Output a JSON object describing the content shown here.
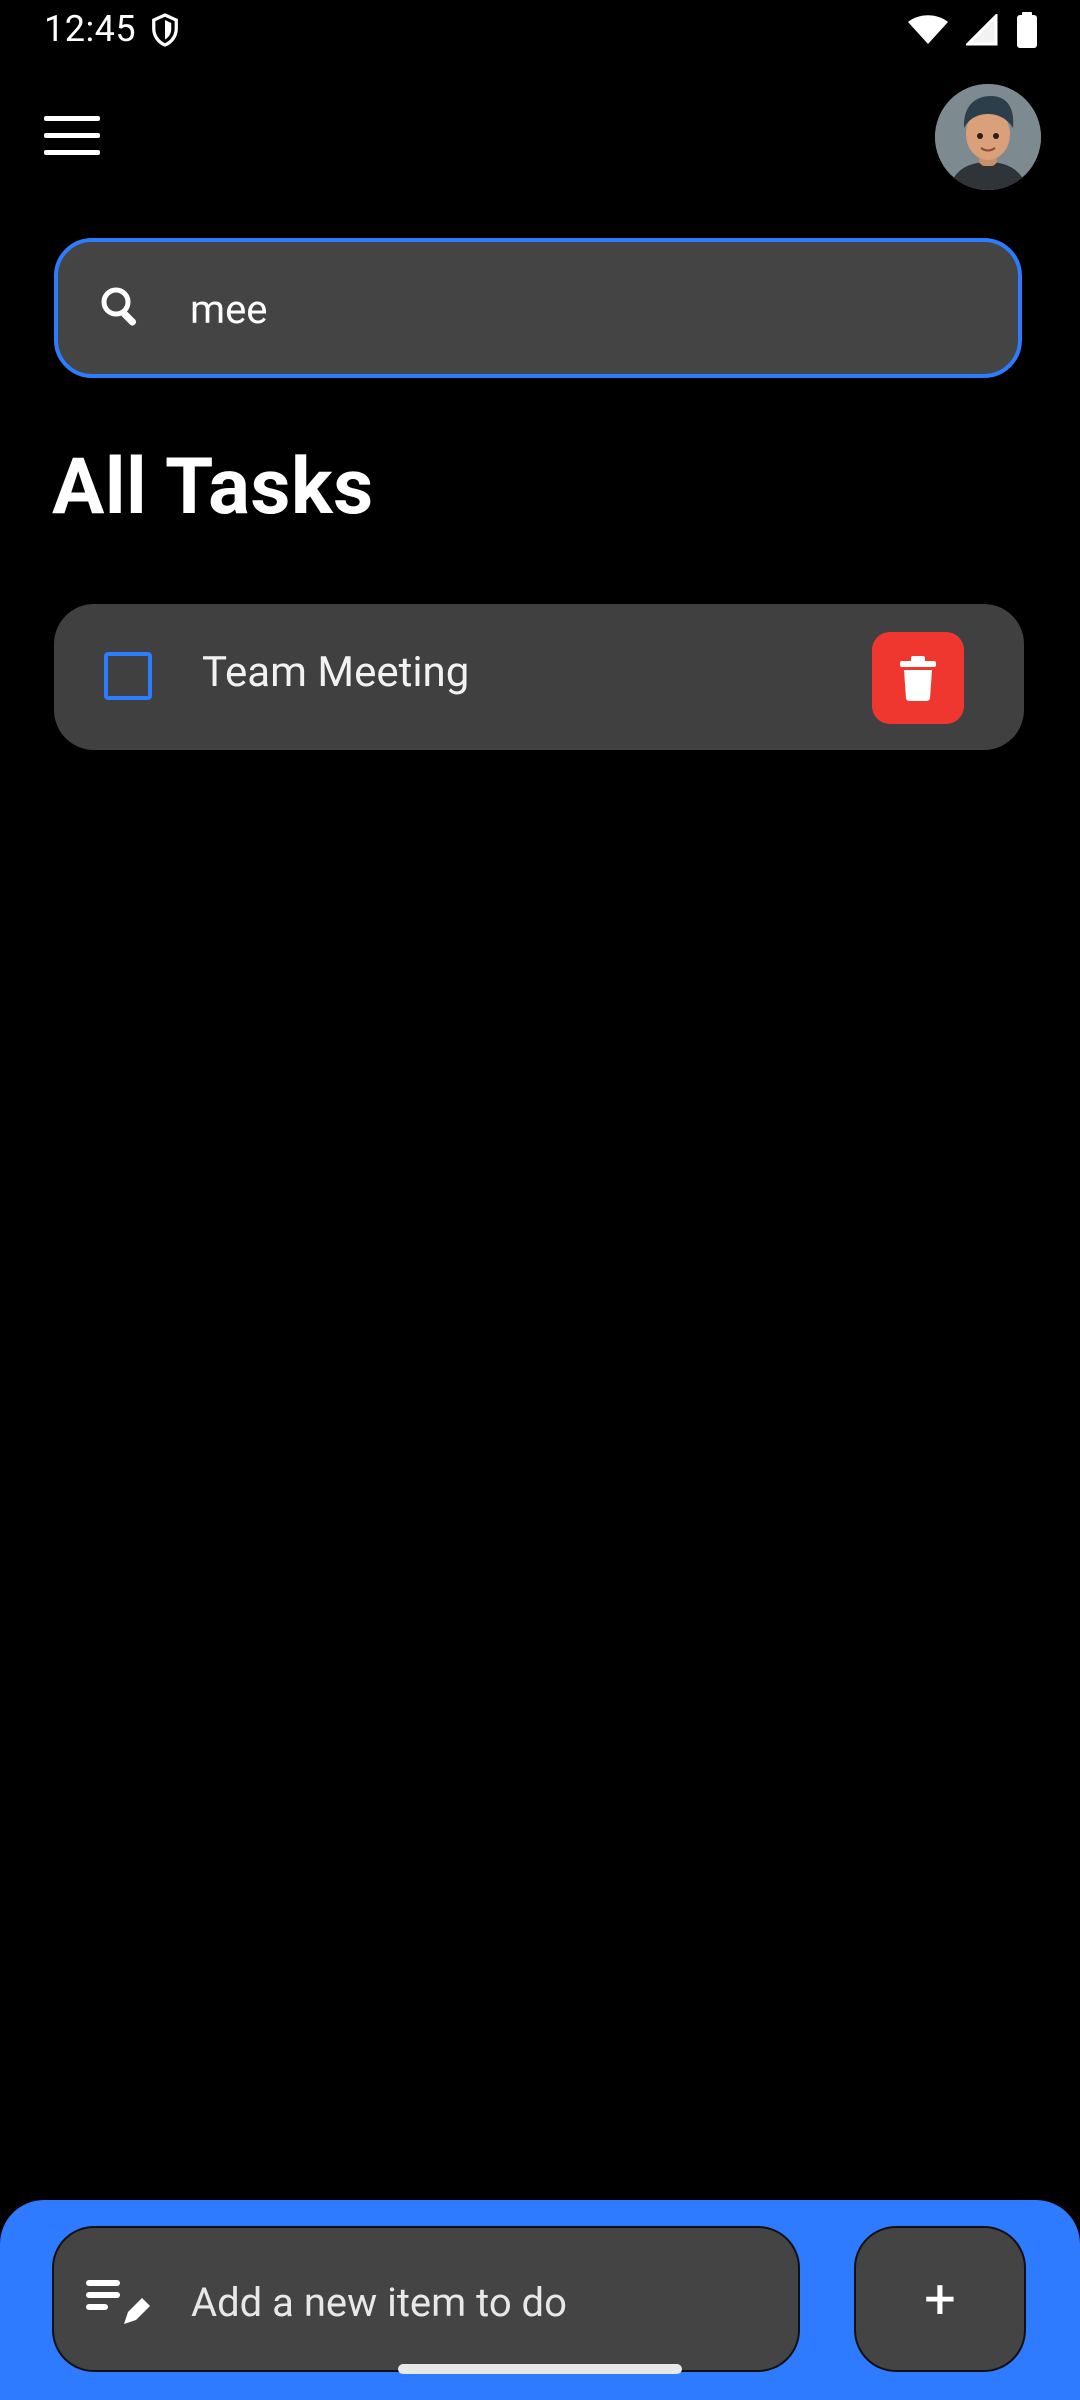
{
  "status_bar": {
    "time": "12:45",
    "icons": [
      "shield-icon",
      "wifi-icon",
      "signal-icon",
      "battery-icon"
    ]
  },
  "app_bar": {
    "menu_icon": "menu-icon",
    "avatar": "profile-avatar"
  },
  "search": {
    "value": "mee",
    "icon": "search-icon"
  },
  "section": {
    "title": "All Tasks"
  },
  "tasks": [
    {
      "label": "Team Meeting",
      "checked": false
    }
  ],
  "bottom_bar": {
    "placeholder": "Add a new item to do",
    "add_button_label": "+",
    "colors": {
      "bar": "#2f7bff",
      "field": "#444444"
    }
  },
  "colors": {
    "accent": "#2b7cff",
    "delete": "#f0372f",
    "background": "#000000",
    "card": "#404040"
  }
}
